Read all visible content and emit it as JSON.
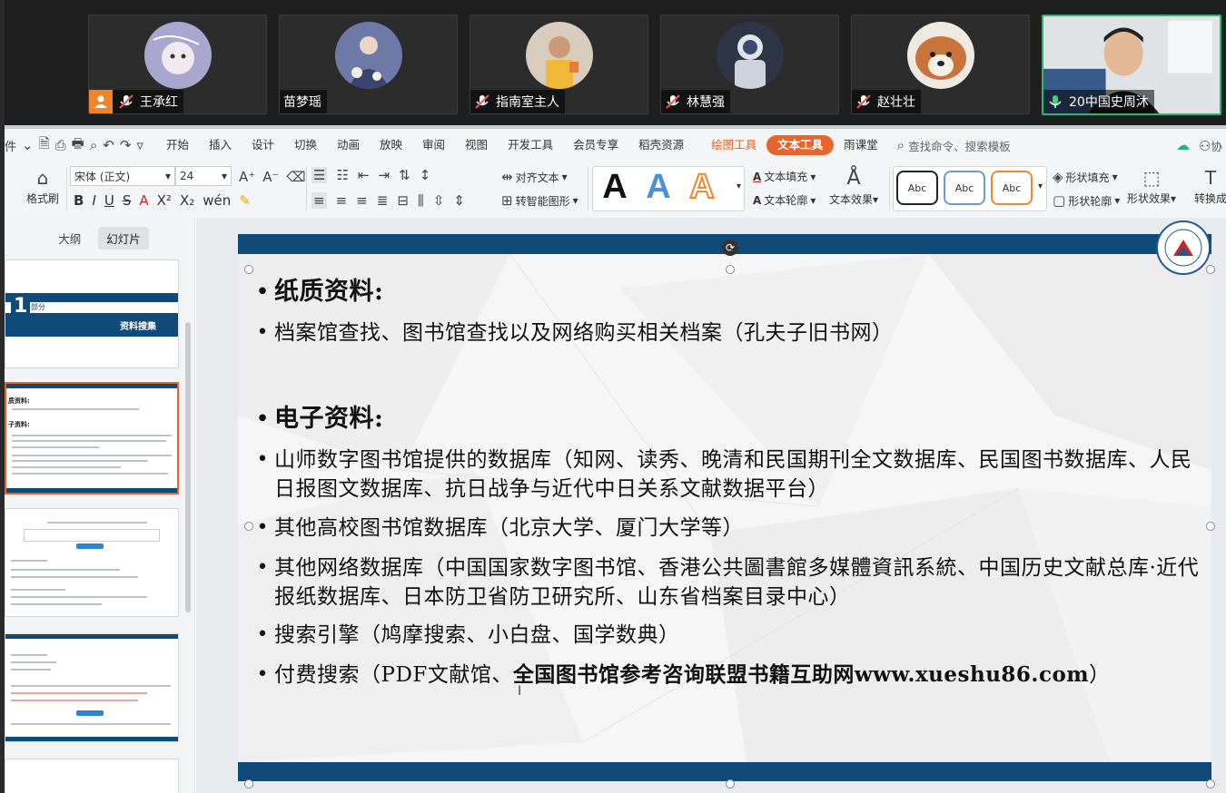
{
  "meeting": {
    "participants": [
      {
        "name": "王承红",
        "mic": "muted",
        "host": true
      },
      {
        "name": "苗梦瑶",
        "mic": "none",
        "host": false
      },
      {
        "name": "指南室主人",
        "mic": "muted",
        "host": false
      },
      {
        "name": "林慧强",
        "mic": "muted",
        "host": false
      },
      {
        "name": "赵壮壮",
        "mic": "muted",
        "host": false
      },
      {
        "name": "20中国史周沐",
        "mic": "speaking",
        "host": false
      }
    ]
  },
  "ribbon": {
    "file_menu": "件",
    "tabs": [
      "开始",
      "插入",
      "设计",
      "切换",
      "动画",
      "放映",
      "审阅",
      "视图",
      "开发工具",
      "会员专享",
      "稻壳资源"
    ],
    "context_tabs": {
      "drawing": "绘图工具",
      "text": "文本工具",
      "rain": "雨课堂"
    },
    "search_placeholder": "查找命令、搜索模板",
    "share_label": "协",
    "format_painter": "格式刷",
    "font_name": "宋体 (正文)",
    "font_size": "24",
    "align_text": "对齐文本",
    "smart_shape": "转智能图形",
    "text_fill": "文本填充",
    "text_outline": "文本轮廓",
    "text_effect": "文本效果",
    "shape_fill": "形状填充",
    "shape_outline": "形状轮廓",
    "shape_effect": "形状效果",
    "convert": "转换成",
    "sample_letter": "A",
    "shape_sample": "Abc",
    "colors": {
      "accent": "#e8642c",
      "blue_a": "#4a90d9",
      "orange_a": "#f0862f"
    }
  },
  "panel": {
    "tabs": [
      "大纲",
      "幻灯片"
    ],
    "thumb1": {
      "number": "1",
      "part": "部分",
      "title": "资料搜集"
    },
    "thumb2_lines": [
      "质资料:",
      "子资料:"
    ]
  },
  "slide": {
    "heading1": "纸质资料:",
    "line1": "档案馆查找、图书馆查找以及网络购买相关档案（孔夫子旧书网）",
    "heading2": "电子资料:",
    "line2": "山师数字图书馆提供的数据库（知网、读秀、晚清和民国期刊全文数据库、民国图书数据库、人民日报图文数据库、抗日战争与近代中日关系文献数据平台）",
    "line3": "其他高校图书馆数据库（北京大学、厦门大学等）",
    "line4": "其他网络数据库（中国国家数字图书馆、香港公共圖書館多媒體資訊系統、中国历史文献总库·近代报纸数据库、日本防卫省防卫研究所、山东省档案目录中心）",
    "line5": "搜索引擎（鸠摩搜索、小白盘、国学数典）",
    "line6_prefix": "付费搜索（PDF文献馆、",
    "line6_bold": "全国图书馆参考咨询联盟书籍互助网www.xueshu86.com",
    "line6_suffix": "）",
    "bullet": "•",
    "band_color": "#0f4a78"
  }
}
